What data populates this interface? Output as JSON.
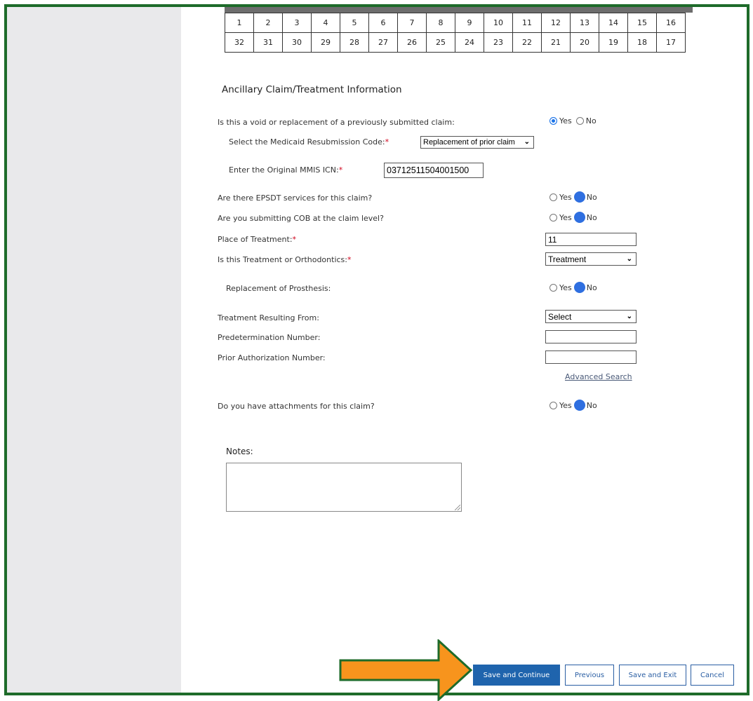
{
  "tooth_chart": {
    "upper": [
      "1",
      "2",
      "3",
      "4",
      "5",
      "6",
      "7",
      "8",
      "9",
      "10",
      "11",
      "12",
      "13",
      "14",
      "15",
      "16"
    ],
    "lower": [
      "32",
      "31",
      "30",
      "29",
      "28",
      "27",
      "26",
      "25",
      "24",
      "23",
      "22",
      "21",
      "20",
      "19",
      "18",
      "17"
    ]
  },
  "section_title": "Ancillary Claim/Treatment Information",
  "void_question": {
    "label": "Is this a void or replacement of a previously submitted claim:",
    "yes": "Yes",
    "no": "No",
    "selected": "Yes"
  },
  "resubmission": {
    "label": "Select the Medicaid Resubmission Code:",
    "required_mark": "*",
    "value": "Replacement of prior claim"
  },
  "original_icn": {
    "label": "Enter the Original MMIS ICN:",
    "required_mark": "*",
    "value": "03712511504001500"
  },
  "epsdt": {
    "label": "Are there EPSDT services for this claim?",
    "yes": "Yes",
    "no": "No",
    "selected": "No"
  },
  "cob": {
    "label": "Are you submitting COB at the claim level?",
    "yes": "Yes",
    "no": "No",
    "selected": "No"
  },
  "place_of_treatment": {
    "label": "Place of Treatment:",
    "required_mark": "*",
    "value": "11"
  },
  "treatment_type": {
    "label": "Is this Treatment or Orthodontics:",
    "required_mark": "*",
    "value": "Treatment"
  },
  "prosthesis": {
    "label": "Replacement of Prosthesis:",
    "yes": "Yes",
    "no": "No",
    "selected": "No"
  },
  "treatment_resulting": {
    "label": "Treatment Resulting From:",
    "value": "Select"
  },
  "predetermination": {
    "label": "Predetermination Number:",
    "value": ""
  },
  "prior_auth": {
    "label": "Prior Authorization Number:",
    "value": ""
  },
  "advanced_search": "Advanced Search",
  "attachments": {
    "label": "Do you have attachments for this claim?",
    "yes": "Yes",
    "no": "No",
    "selected": "No"
  },
  "notes": {
    "label": "Notes:",
    "value": ""
  },
  "buttons": {
    "save_continue": "Save and Continue",
    "previous": "Previous",
    "save_exit": "Save and Exit",
    "cancel": "Cancel"
  },
  "colors": {
    "frame": "#1e6b2a",
    "arrow_fill": "#f7941d",
    "primary_button": "#1f64ad",
    "required": "#d0021b"
  }
}
